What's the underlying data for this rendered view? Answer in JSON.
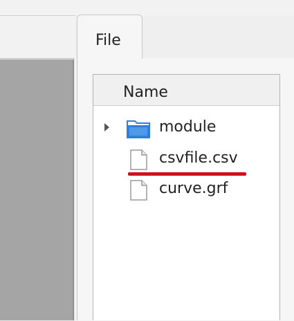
{
  "tabs": [
    {
      "label": "File"
    }
  ],
  "file_tree": {
    "column_header": "Name",
    "items": [
      {
        "name": "module",
        "icon": "folder-icon",
        "expandable": true
      },
      {
        "name": "csvfile.csv",
        "icon": "file-icon",
        "expandable": false,
        "highlighted": true
      },
      {
        "name": "curve.grf",
        "icon": "file-icon",
        "expandable": false
      }
    ]
  },
  "colors": {
    "highlight_underline": "#d0101a",
    "folder_icon": "#2f7fd8",
    "left_panel": "#a5a5a5"
  }
}
